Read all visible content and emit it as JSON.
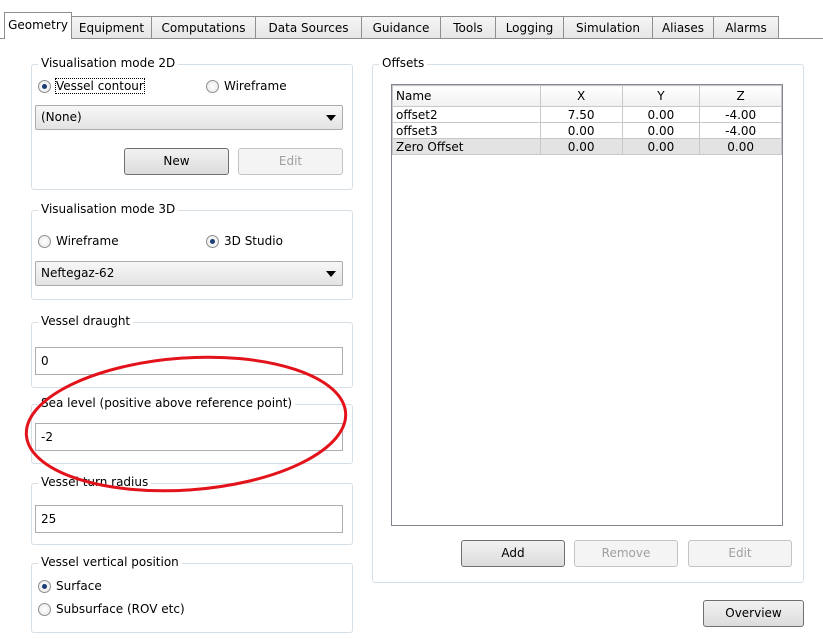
{
  "tabs": [
    "Geometry",
    "Equipment",
    "Computations",
    "Data Sources",
    "Guidance",
    "Tools",
    "Logging",
    "Simulation",
    "Aliases",
    "Alarms"
  ],
  "vis2d": {
    "legend": "Visualisation mode 2D",
    "radio_contour": "Vessel contour",
    "radio_wireframe": "Wireframe",
    "combo_value": "(None)",
    "new_label": "New",
    "edit_label": "Edit"
  },
  "vis3d": {
    "legend": "Visualisation mode 3D",
    "radio_wireframe": "Wireframe",
    "radio_studio": "3D Studio",
    "combo_value": "Neftegaz-62"
  },
  "draught": {
    "legend": "Vessel draught",
    "value": "0"
  },
  "sealevel": {
    "legend": "Sea level (positive above reference point)",
    "value": "-2"
  },
  "turn": {
    "legend": "Vessel turn radius",
    "value": "25"
  },
  "vertical": {
    "legend": "Vessel vertical position",
    "radio_surface": "Surface",
    "radio_subsurface": "Subsurface (ROV etc)"
  },
  "offsets": {
    "legend": "Offsets",
    "columns": [
      "Name",
      "X",
      "Y",
      "Z"
    ],
    "rows": [
      {
        "name": "offset2",
        "x": "7.50",
        "y": "0.00",
        "z": "-4.00"
      },
      {
        "name": "offset3",
        "x": "0.00",
        "y": "0.00",
        "z": "-4.00"
      },
      {
        "name": "Zero Offset",
        "x": "0.00",
        "y": "0.00",
        "z": "0.00"
      }
    ],
    "add_label": "Add",
    "remove_label": "Remove",
    "edit_label": "Edit"
  },
  "overview_label": "Overview",
  "annotation_color": "#e3131b"
}
